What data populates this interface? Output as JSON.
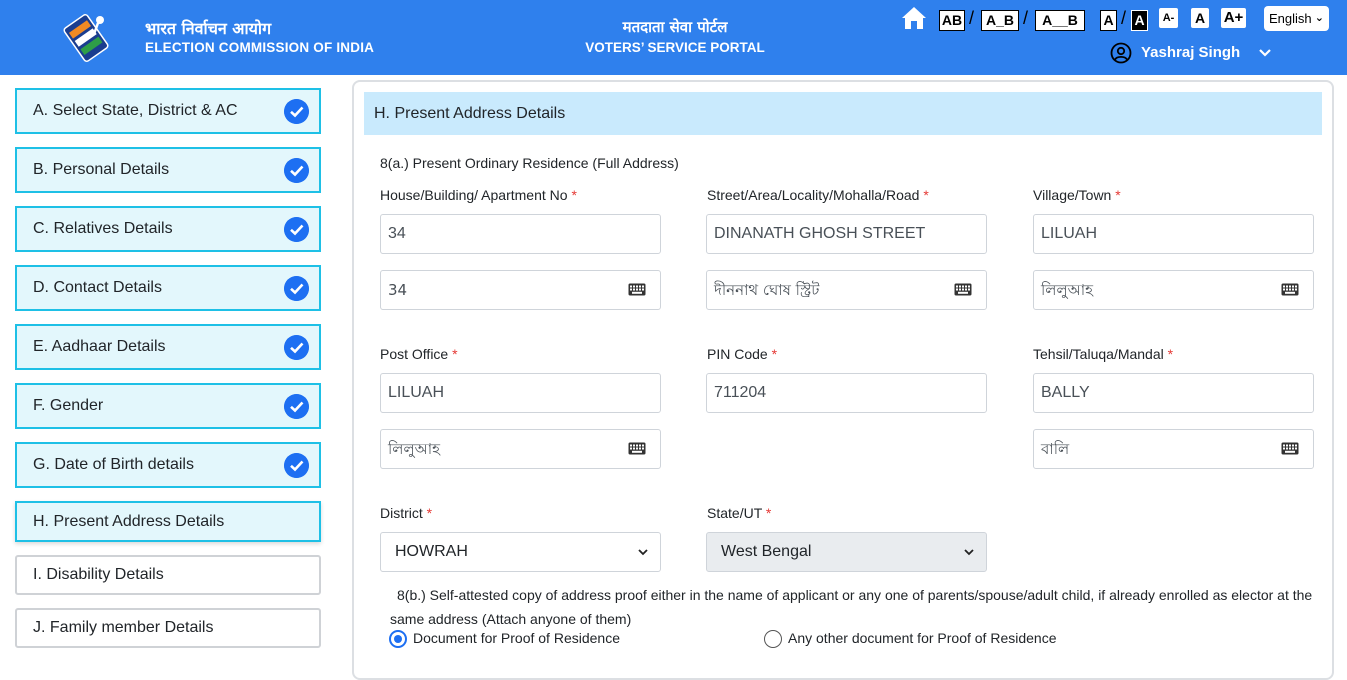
{
  "header": {
    "brand_hindi": "भारत निर्वाचन आयोग",
    "brand_english": "ELECTION COMMISSION OF INDIA",
    "portal_hindi": "मतदाता सेवा पोर्टल",
    "portal_english": "VOTERS’ SERVICE PORTAL",
    "home_icon": "home-icon",
    "text_spacing": [
      "AB",
      "A_B",
      "A__B"
    ],
    "contrast": [
      "A",
      "A"
    ],
    "font_size": [
      "A-",
      "A",
      "A+"
    ],
    "language": "English",
    "user_name": "Yashraj Singh",
    "colors": {
      "header_bg": "#2f80ed",
      "check_blue": "#1d6ff2",
      "step_border": "#1ec0e6",
      "section_bg": "#c9eafd",
      "required": "#e53935"
    }
  },
  "sidebar": {
    "steps": [
      {
        "label": "A. Select State, District & AC",
        "status": "completed"
      },
      {
        "label": "B. Personal Details",
        "status": "completed"
      },
      {
        "label": "C. Relatives Details",
        "status": "completed"
      },
      {
        "label": "D. Contact Details",
        "status": "completed"
      },
      {
        "label": "E. Aadhaar Details",
        "status": "completed"
      },
      {
        "label": "F. Gender",
        "status": "completed"
      },
      {
        "label": "G. Date of Birth details",
        "status": "completed"
      },
      {
        "label": "H. Present Address Details",
        "status": "active"
      },
      {
        "label": "I. Disability Details",
        "status": "pending"
      },
      {
        "label": "J. Family member Details",
        "status": "pending"
      }
    ]
  },
  "form": {
    "section_title": "H. Present Address Details",
    "subheading": "8(a.) Present Ordinary Residence (Full Address)",
    "required_mark": "*",
    "fields": {
      "house": {
        "label": "House/Building/ Apartment No",
        "value": "34",
        "regional": "34"
      },
      "street": {
        "label": "Street/Area/Locality/Mohalla/Road",
        "value": "DINANATH GHOSH STREET",
        "regional": "দীননাথ ঘোষ স্ট্রিট"
      },
      "village": {
        "label": "Village/Town",
        "value": "LILUAH",
        "regional": "লিলুআহ"
      },
      "post_office": {
        "label": "Post Office",
        "value": "LILUAH",
        "regional": "লিলুআহ"
      },
      "pin": {
        "label": "PIN Code",
        "value": "711204"
      },
      "tehsil": {
        "label": "Tehsil/Taluqa/Mandal",
        "value": "BALLY",
        "regional": "বালি"
      },
      "district": {
        "label": "District",
        "value": "HOWRAH"
      },
      "state": {
        "label": "State/UT",
        "value": "West Bengal"
      }
    },
    "proof_note": "8(b.) Self-attested copy of address proof either in the name of applicant or any one of parents/spouse/adult child, if already enrolled as elector at the same address (Attach anyone of them)",
    "proof_options": [
      {
        "label": "Document for Proof of Residence",
        "selected": true
      },
      {
        "label": "Any other document for Proof of Residence",
        "selected": false
      }
    ]
  }
}
